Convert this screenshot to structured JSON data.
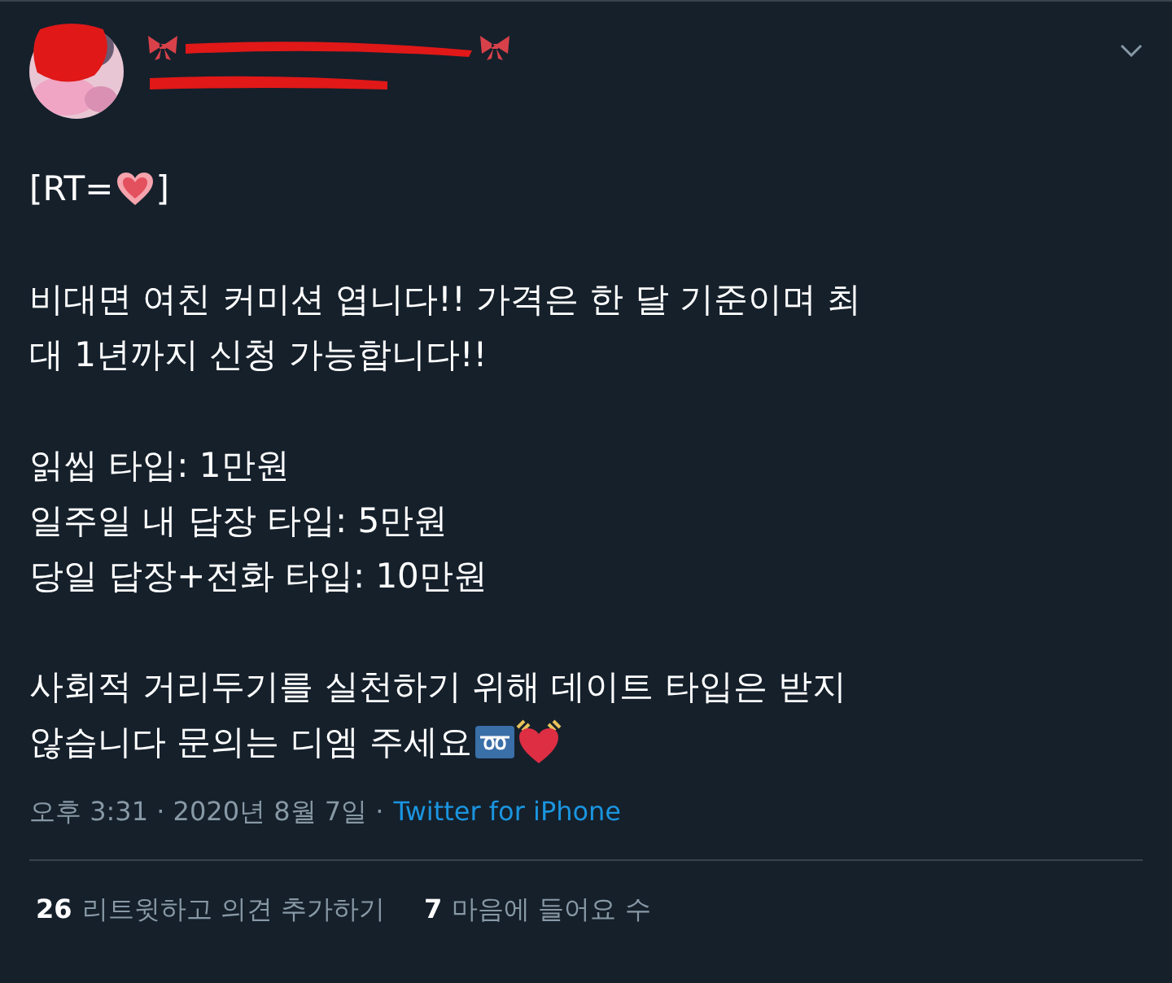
{
  "tweet": {
    "author": {
      "redacted": true
    },
    "rt_line": {
      "before": "[RT=",
      "after": "]"
    },
    "paragraph_lines": [
      "비대면 여친 커미션 엽니다!! 가격은 한 달 기준이며 최",
      "대 1년까지 신청 가능합니다!!"
    ],
    "price_lines": [
      "읽씹 타입: 1만원",
      "일주일 내 답장 타입: 5만원",
      "당일 답장+전화 타입: 10만원"
    ],
    "closing_lines": [
      "사회적 거리두기를 실천하기 위해 데이트 타입은 받지",
      "않습니다 문의는 디엠 주세요"
    ],
    "meta": {
      "time": "오후 3:31 · 2020년 8월 7일 ·",
      "source": "Twitter for iPhone"
    },
    "stats": [
      {
        "count": "26",
        "label": "리트윗하고 의견 추가하기"
      },
      {
        "count": "7",
        "label": "마음에 들어요 수"
      }
    ]
  }
}
